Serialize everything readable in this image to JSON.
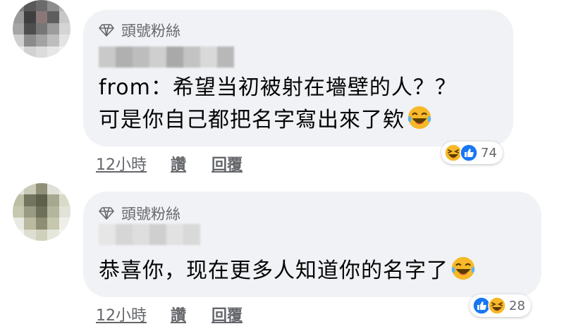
{
  "comments": [
    {
      "badge": "頭號粉絲",
      "lines": [
        "from：希望当初被射在墻壁的人？？",
        "可是你自己都把名字寫出來了欸"
      ],
      "emoji": "laughing-tears-emoji",
      "time": "12小時",
      "like_label": "讚",
      "reply_label": "回覆",
      "reaction_icons": [
        "haha-reaction-icon",
        "like-reaction-icon"
      ],
      "reaction_count": "74"
    },
    {
      "badge": "頭號粉絲",
      "lines": [
        "恭喜你，现在更多人知道你的名字了"
      ],
      "emoji": "laughing-tears-emoji",
      "time": "12小時",
      "like_label": "讚",
      "reply_label": "回覆",
      "reaction_icons": [
        "like-reaction-icon",
        "haha-reaction-icon"
      ],
      "reaction_count": "28"
    }
  ],
  "colors": {
    "bubble": "#f0f2f5",
    "meta_text": "#65676b",
    "body_text": "#050505",
    "like_blue": "#1877f2",
    "haha_yellow": "#f7b928"
  }
}
